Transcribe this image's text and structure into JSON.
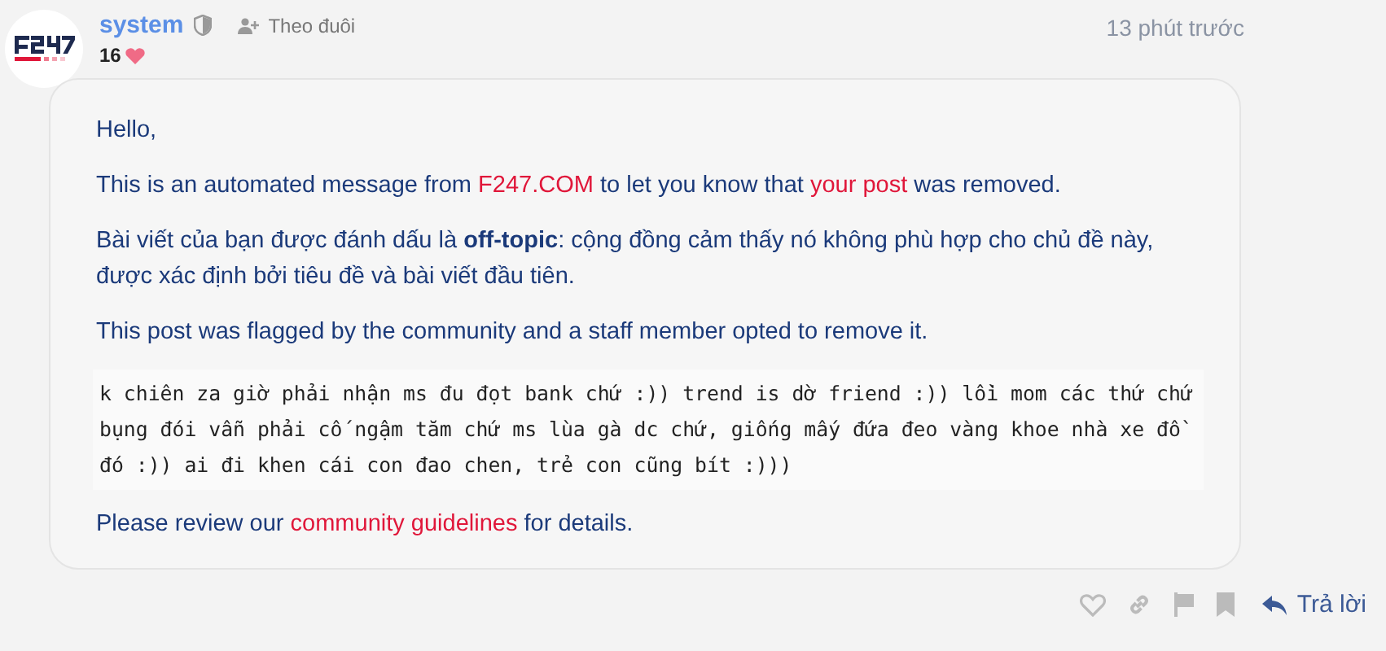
{
  "post": {
    "username": "system",
    "follow_label": "Theo đuôi",
    "likes": "16",
    "time": "13 phút trước",
    "paragraphs": [
      [
        {
          "kind": "text",
          "text": "Hello,"
        }
      ],
      [
        {
          "kind": "text",
          "text": "This is an automated message from "
        },
        {
          "kind": "link",
          "text": "F247.COM"
        },
        {
          "kind": "text",
          "text": " to let you know that "
        },
        {
          "kind": "link",
          "text": "your post"
        },
        {
          "kind": "text",
          "text": " was removed."
        }
      ],
      [
        {
          "kind": "text",
          "text": "Bài viết của bạn được đánh dấu là **off-topic**: cộng đồng cảm thấy nó không phù hợp cho chủ đề này, được xác định bởi tiêu đề và bài viết đầu tiên."
        }
      ],
      [
        {
          "kind": "text",
          "text": "This post was flagged by the community and a staff member opted to remove it."
        }
      ],
      [
        {
          "kind": "code",
          "text": "k chiên za giờ phải nhận ms đu đọt bank chứ :)) trend is dờ friend :)) lồi mom các thứ chứ bụng đói vẫn phải cố ngậm tăm chứ ms lùa gà dc chứ, giống mấy đứa đeo vàng khoe nhà xe đồ đó :)) ai đi khen cái con đao chen, trẻ con cũng bít :)))"
        }
      ],
      [
        {
          "kind": "text",
          "text": "Please review our "
        },
        {
          "kind": "link",
          "text": "community guidelines"
        },
        {
          "kind": "text",
          "text": " for details."
        }
      ]
    ],
    "reply_label": "Trả lời"
  }
}
